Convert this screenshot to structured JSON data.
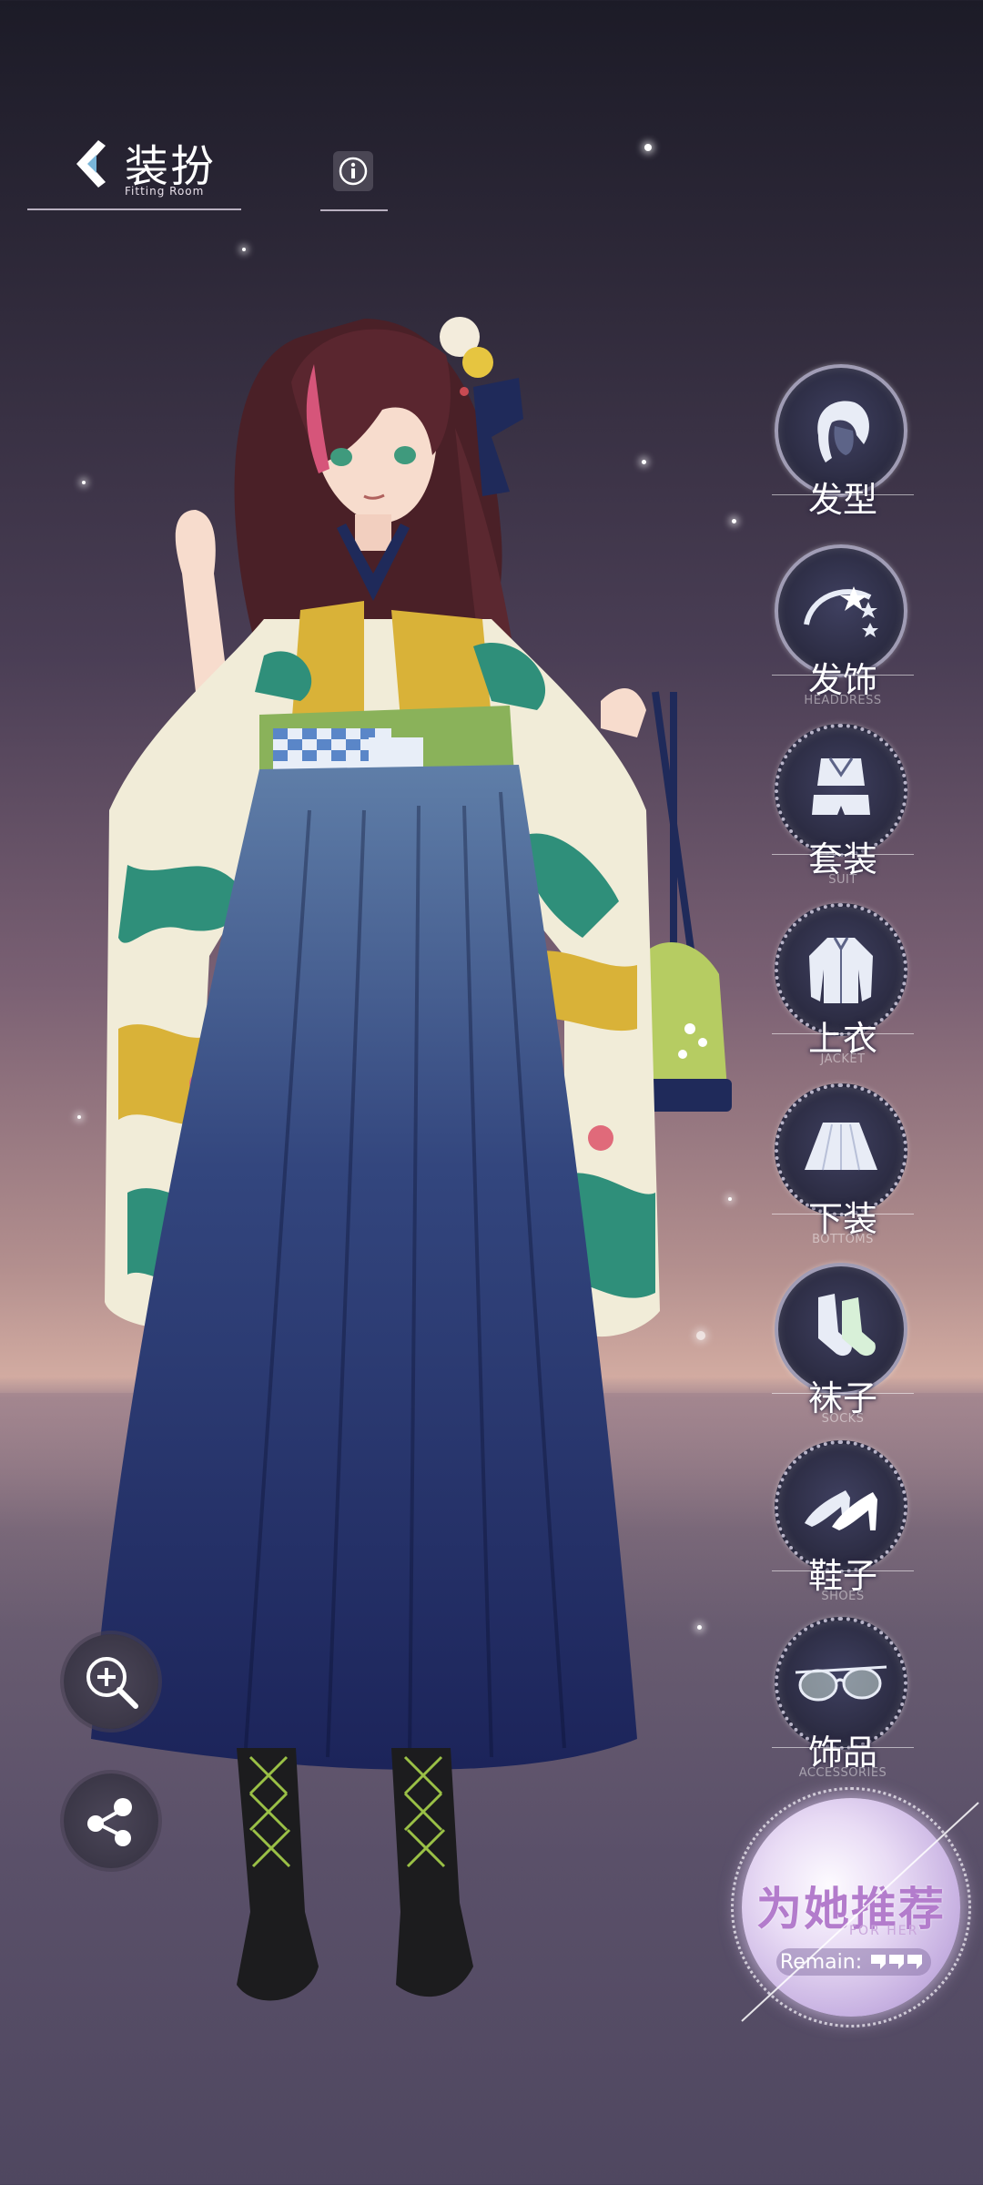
{
  "header": {
    "title": "装扮",
    "subtitle": "Fitting Room"
  },
  "categories": [
    {
      "label": "发型",
      "en": "",
      "icon": "hairstyle-icon"
    },
    {
      "label": "发饰",
      "en": "HEADDRESS",
      "icon": "headdress-icon"
    },
    {
      "label": "套装",
      "en": "SUIT",
      "icon": "suit-icon"
    },
    {
      "label": "上衣",
      "en": "JACKET",
      "icon": "jacket-icon"
    },
    {
      "label": "下装",
      "en": "BOTTOMS",
      "icon": "skirt-icon"
    },
    {
      "label": "袜子",
      "en": "SOCKS",
      "icon": "socks-icon"
    },
    {
      "label": "鞋子",
      "en": "SHOES",
      "icon": "shoes-icon"
    },
    {
      "label": "饰品",
      "en": "ACCESSORIES",
      "icon": "glasses-icon"
    }
  ],
  "tools": {
    "zoom": "zoom-in-icon",
    "share": "share-icon"
  },
  "recommend": {
    "title": "为她推荐",
    "subtitle": "FOR HER",
    "remain_label": "Remain:",
    "remain_count": 3
  },
  "colors": {
    "accent": "#b37ccc",
    "skirt": "#1e2a5c",
    "kimono": "#f1ecd8",
    "kimono_green": "#2f8f7a",
    "kimono_yellow": "#d9b238"
  }
}
